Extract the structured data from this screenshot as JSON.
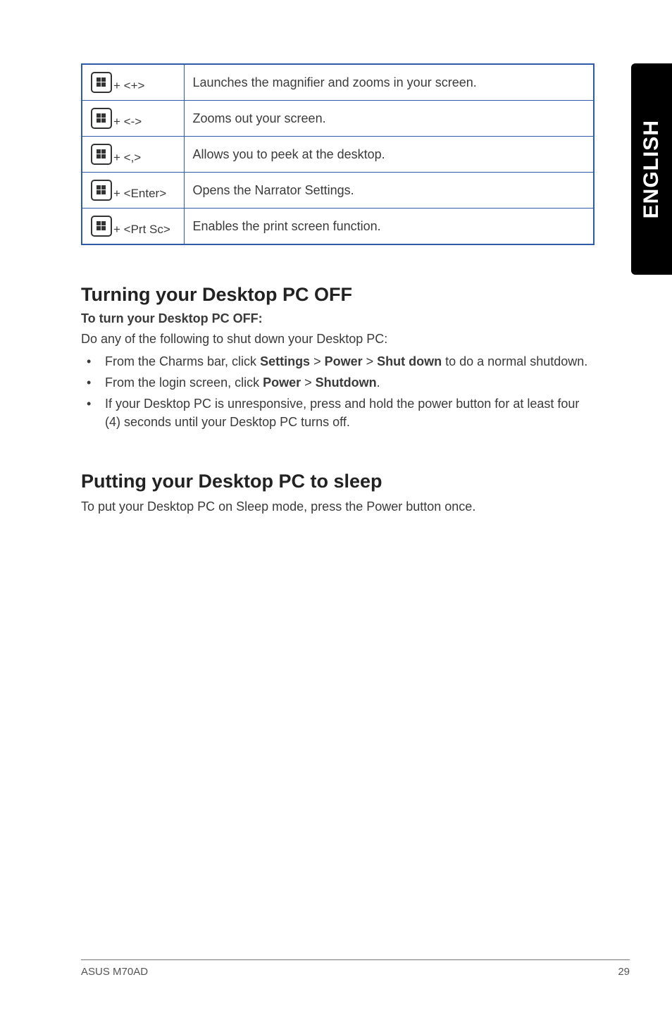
{
  "sidebar": {
    "label": "ENGLISH"
  },
  "shortcuts": [
    {
      "combo": "+ <+>",
      "desc": "Launches the magnifier and zooms in your screen."
    },
    {
      "combo": "+ <->",
      "desc": "Zooms out your screen."
    },
    {
      "combo": "+ <,>",
      "desc": "Allows you to peek at the desktop."
    },
    {
      "combo": "+ <Enter>",
      "desc": "Opens the Narrator Settings."
    },
    {
      "combo": "+ <Prt Sc>",
      "desc": "Enables the print screen function."
    }
  ],
  "section1": {
    "title_prefix": "Turning your ",
    "title_bold": "Desktop PC OFF",
    "subhead": "To turn your Desktop PC OFF:",
    "intro": "Do any of the following to shut down your Desktop PC:",
    "bullets": [
      {
        "pre": "From the Charms bar, click ",
        "b1": "Settings",
        "mid1": " > ",
        "b2": "Power",
        "mid2": " > ",
        "b3": "Shut down",
        "post": " to do a normal shutdown."
      },
      {
        "pre": "From the login screen, click ",
        "b1": "Power",
        "mid1": " > ",
        "b2": "Shutdown",
        "post": "."
      },
      {
        "plain": "If your Desktop PC is unresponsive, press and hold the power  button for at least four (4) seconds until your Desktop PC turns off."
      }
    ]
  },
  "section2": {
    "title": "Putting your Desktop PC to sleep",
    "body": "To put your Desktop PC on Sleep mode, press the Power button once."
  },
  "footer": {
    "left": "ASUS M70AD",
    "right": "29"
  }
}
